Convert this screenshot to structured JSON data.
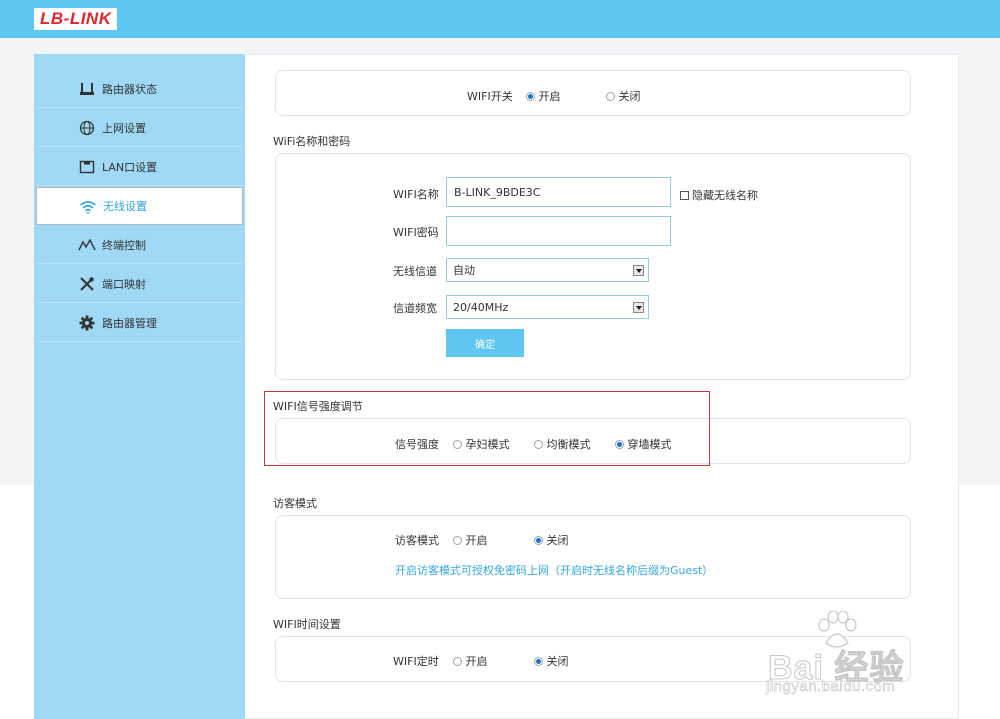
{
  "brand": {
    "logo_text": "LB-LINK"
  },
  "sidebar": {
    "items": [
      {
        "label": "路由器状态",
        "icon": "router-status-icon"
      },
      {
        "label": "上网设置",
        "icon": "globe-icon"
      },
      {
        "label": "LAN口设置",
        "icon": "monitor-icon"
      },
      {
        "label": "无线设置",
        "icon": "wifi-icon",
        "active": true
      },
      {
        "label": "终端控制",
        "icon": "chart-line-icon"
      },
      {
        "label": "端口映射",
        "icon": "tools-icon"
      },
      {
        "label": "路由器管理",
        "icon": "gear-icon"
      }
    ]
  },
  "wifi_switch": {
    "label": "WIFI开关",
    "on_label": "开启",
    "off_label": "关闭",
    "selected": "on"
  },
  "wifi_name_section": {
    "title": "WiFi名称和密码",
    "name_label": "WIFI名称",
    "name_value": "B-LINK_9BDE3C",
    "hide_label": "隐藏无线名称",
    "password_label": "WIFI密码",
    "password_value": "",
    "channel_label": "无线信道",
    "channel_value": "自动",
    "bandwidth_label": "信道频宽",
    "bandwidth_value": "20/40MHz",
    "confirm_label": "确定"
  },
  "signal_section": {
    "title": "WIFI信号强度调节",
    "label": "信号强度",
    "options": [
      "孕妇模式",
      "均衡模式",
      "穿墙模式"
    ],
    "selected_index": 2
  },
  "guest_section": {
    "title": "访客模式",
    "label": "访客模式",
    "on_label": "开启",
    "off_label": "关闭",
    "selected": "off",
    "hint": "开启访客模式可授权免密码上网（开启时无线名称后缀为Guest）"
  },
  "timer_section": {
    "title": "WIFI时间设置",
    "label": "WIFI定时",
    "on_label": "开启",
    "off_label": "关闭",
    "selected": "off"
  },
  "watermark": {
    "text": "Bai 经验",
    "url": "jingyan.baidu.com"
  },
  "colors": {
    "header": "#5fc6f1",
    "sidebar": "#9fd9f5",
    "accent": "#2fa5df",
    "highlight_box": "#c8373b",
    "hint_text": "#32a8e0"
  }
}
